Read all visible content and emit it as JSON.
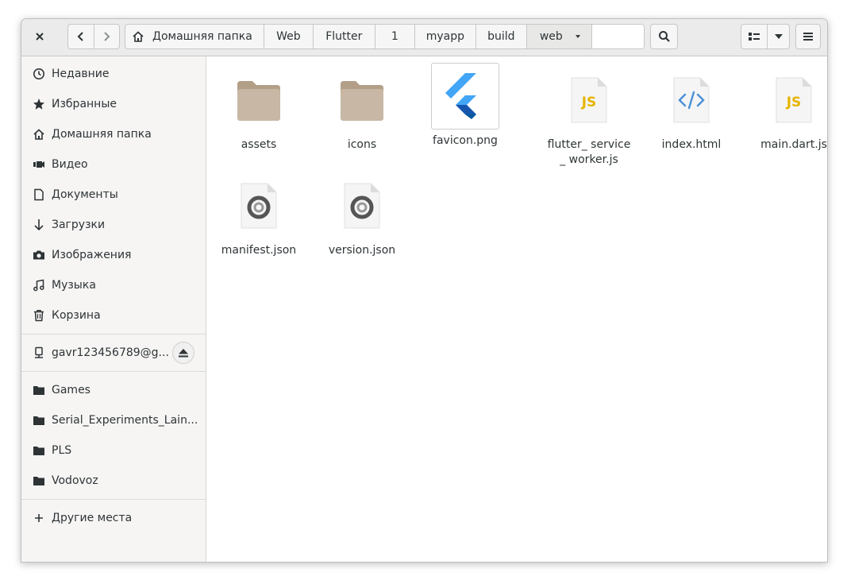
{
  "header": {
    "close_icon": "close-icon",
    "back_icon": "chevron-left-icon",
    "forward_icon": "chevron-right-icon",
    "breadcrumbs": [
      "Домашняя папка",
      "Web",
      "Flutter",
      "1",
      "myapp",
      "build",
      "web"
    ],
    "search_icon": "search-icon",
    "view_icon": "grid-view-icon",
    "view_options_icon": "chevron-down-icon",
    "menu_icon": "hamburger-menu-icon"
  },
  "sidebar": {
    "places": [
      {
        "label": "Недавние",
        "icon": "clock-icon"
      },
      {
        "label": "Избранные",
        "icon": "star-icon"
      },
      {
        "label": "Домашняя папка",
        "icon": "home-icon"
      },
      {
        "label": "Видео",
        "icon": "video-icon"
      },
      {
        "label": "Документы",
        "icon": "document-icon"
      },
      {
        "label": "Загрузки",
        "icon": "download-icon"
      },
      {
        "label": "Изображения",
        "icon": "camera-icon"
      },
      {
        "label": "Музыка",
        "icon": "music-icon"
      },
      {
        "label": "Корзина",
        "icon": "trash-icon"
      }
    ],
    "device": {
      "label": "gavr123456789@g...",
      "icon": "network-drive-icon",
      "eject_icon": "eject-icon"
    },
    "bookmarks": [
      {
        "label": "Games",
        "icon": "folder-icon"
      },
      {
        "label": "Serial_Experiments_Lain...",
        "icon": "folder-icon"
      },
      {
        "label": "PLS",
        "icon": "folder-icon"
      },
      {
        "label": "Vodovoz",
        "icon": "folder-icon"
      }
    ],
    "other_locations": {
      "label": "Другие места",
      "icon": "plus-icon"
    }
  },
  "files": [
    {
      "name": "assets",
      "type": "folder"
    },
    {
      "name": "icons",
      "type": "folder"
    },
    {
      "name": "favicon.png",
      "type": "image"
    },
    {
      "name": "flutter_ service_ worker.js",
      "type": "js"
    },
    {
      "name": "index.html",
      "type": "html"
    },
    {
      "name": "main.dart.js",
      "type": "js"
    },
    {
      "name": "manifest.json",
      "type": "json"
    },
    {
      "name": "version.json",
      "type": "json"
    }
  ],
  "colors": {
    "folder": "#c8b7a4",
    "js_badge": "#e6b400",
    "html_badge": "#4a90d9"
  }
}
